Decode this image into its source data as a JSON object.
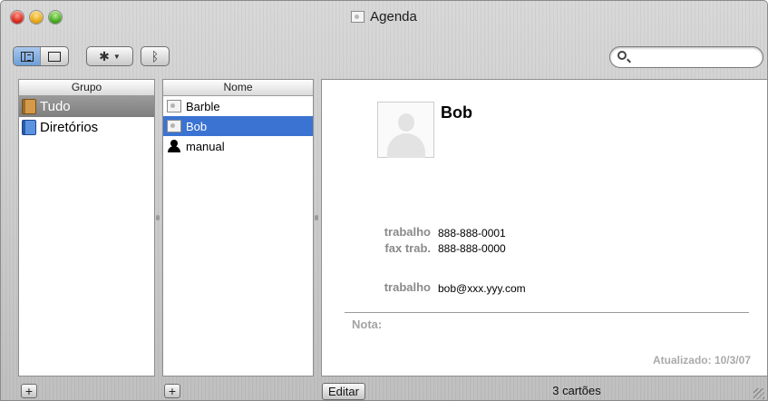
{
  "window": {
    "title": "Agenda"
  },
  "toolbar": {
    "view_buttons": [
      "columns-view",
      "card-view"
    ],
    "search": {
      "value": "",
      "placeholder": ""
    }
  },
  "groups": {
    "header": "Grupo",
    "items": [
      {
        "label": "Tudo",
        "icon": "address-book-icon",
        "selected": true
      },
      {
        "label": "Diretórios",
        "icon": "directory-icon",
        "selected": false
      }
    ]
  },
  "names": {
    "header": "Nome",
    "items": [
      {
        "label": "Barble",
        "icon": "card-icon",
        "selected": false
      },
      {
        "label": "Bob",
        "icon": "card-icon",
        "selected": true
      },
      {
        "label": "manual",
        "icon": "person-icon",
        "selected": false
      }
    ]
  },
  "card": {
    "name": "Bob",
    "fields": [
      {
        "label": "trabalho",
        "value": "888-888-0001"
      },
      {
        "label": "fax trab.",
        "value": "888-888-0000"
      },
      {
        "label": "trabalho",
        "value": "bob@xxx.yyy.com"
      }
    ],
    "note_label": "Nota:",
    "updated": "Atualizado: 10/3/07"
  },
  "bottom": {
    "edit_label": "Editar",
    "count": "3 cartões",
    "add_symbol": "+"
  }
}
